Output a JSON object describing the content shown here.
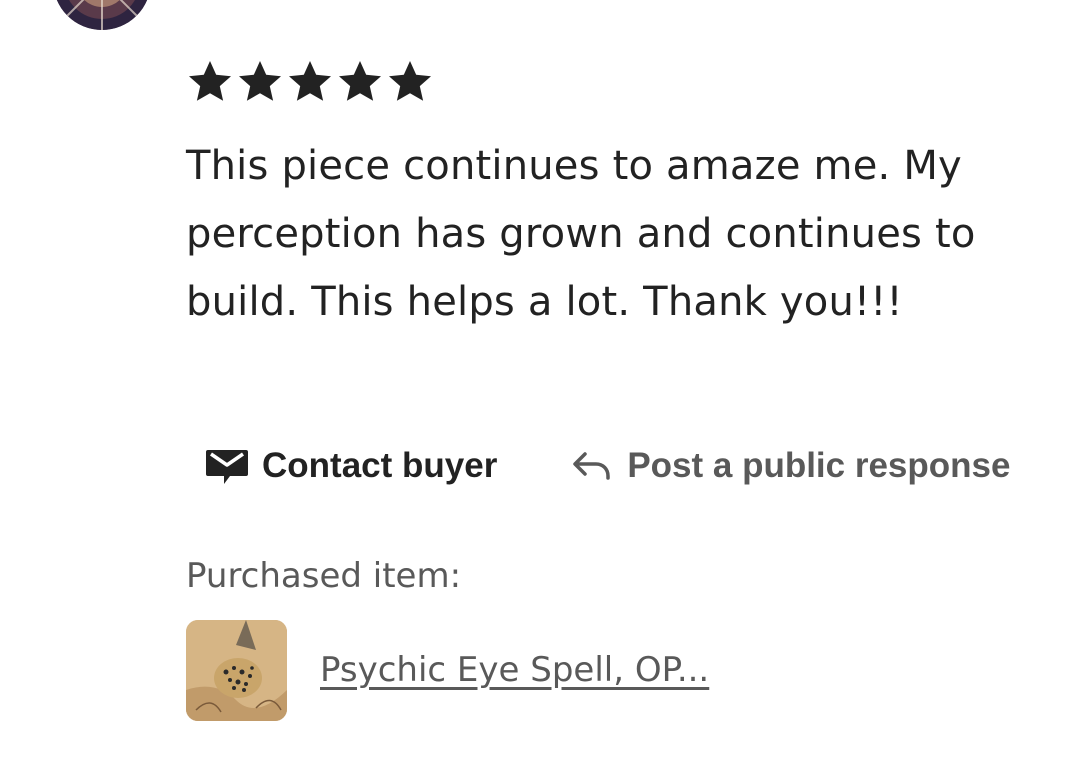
{
  "review": {
    "rating": 5,
    "rating_max": 5,
    "text": "This piece continues to amaze me. My perception has grown and continues to build. This helps a lot. Thank you!!!"
  },
  "actions": {
    "contact_label": "Contact buyer",
    "respond_label": "Post a public response"
  },
  "purchased": {
    "label": "Purchased item:",
    "item_title": "Psychic Eye Spell, OP..."
  },
  "icons": {
    "star": "star-icon",
    "contact": "envelope-icon",
    "respond": "reply-arrow-icon"
  },
  "colors": {
    "text_primary": "#222222",
    "text_secondary": "#595959",
    "background": "#ffffff"
  }
}
